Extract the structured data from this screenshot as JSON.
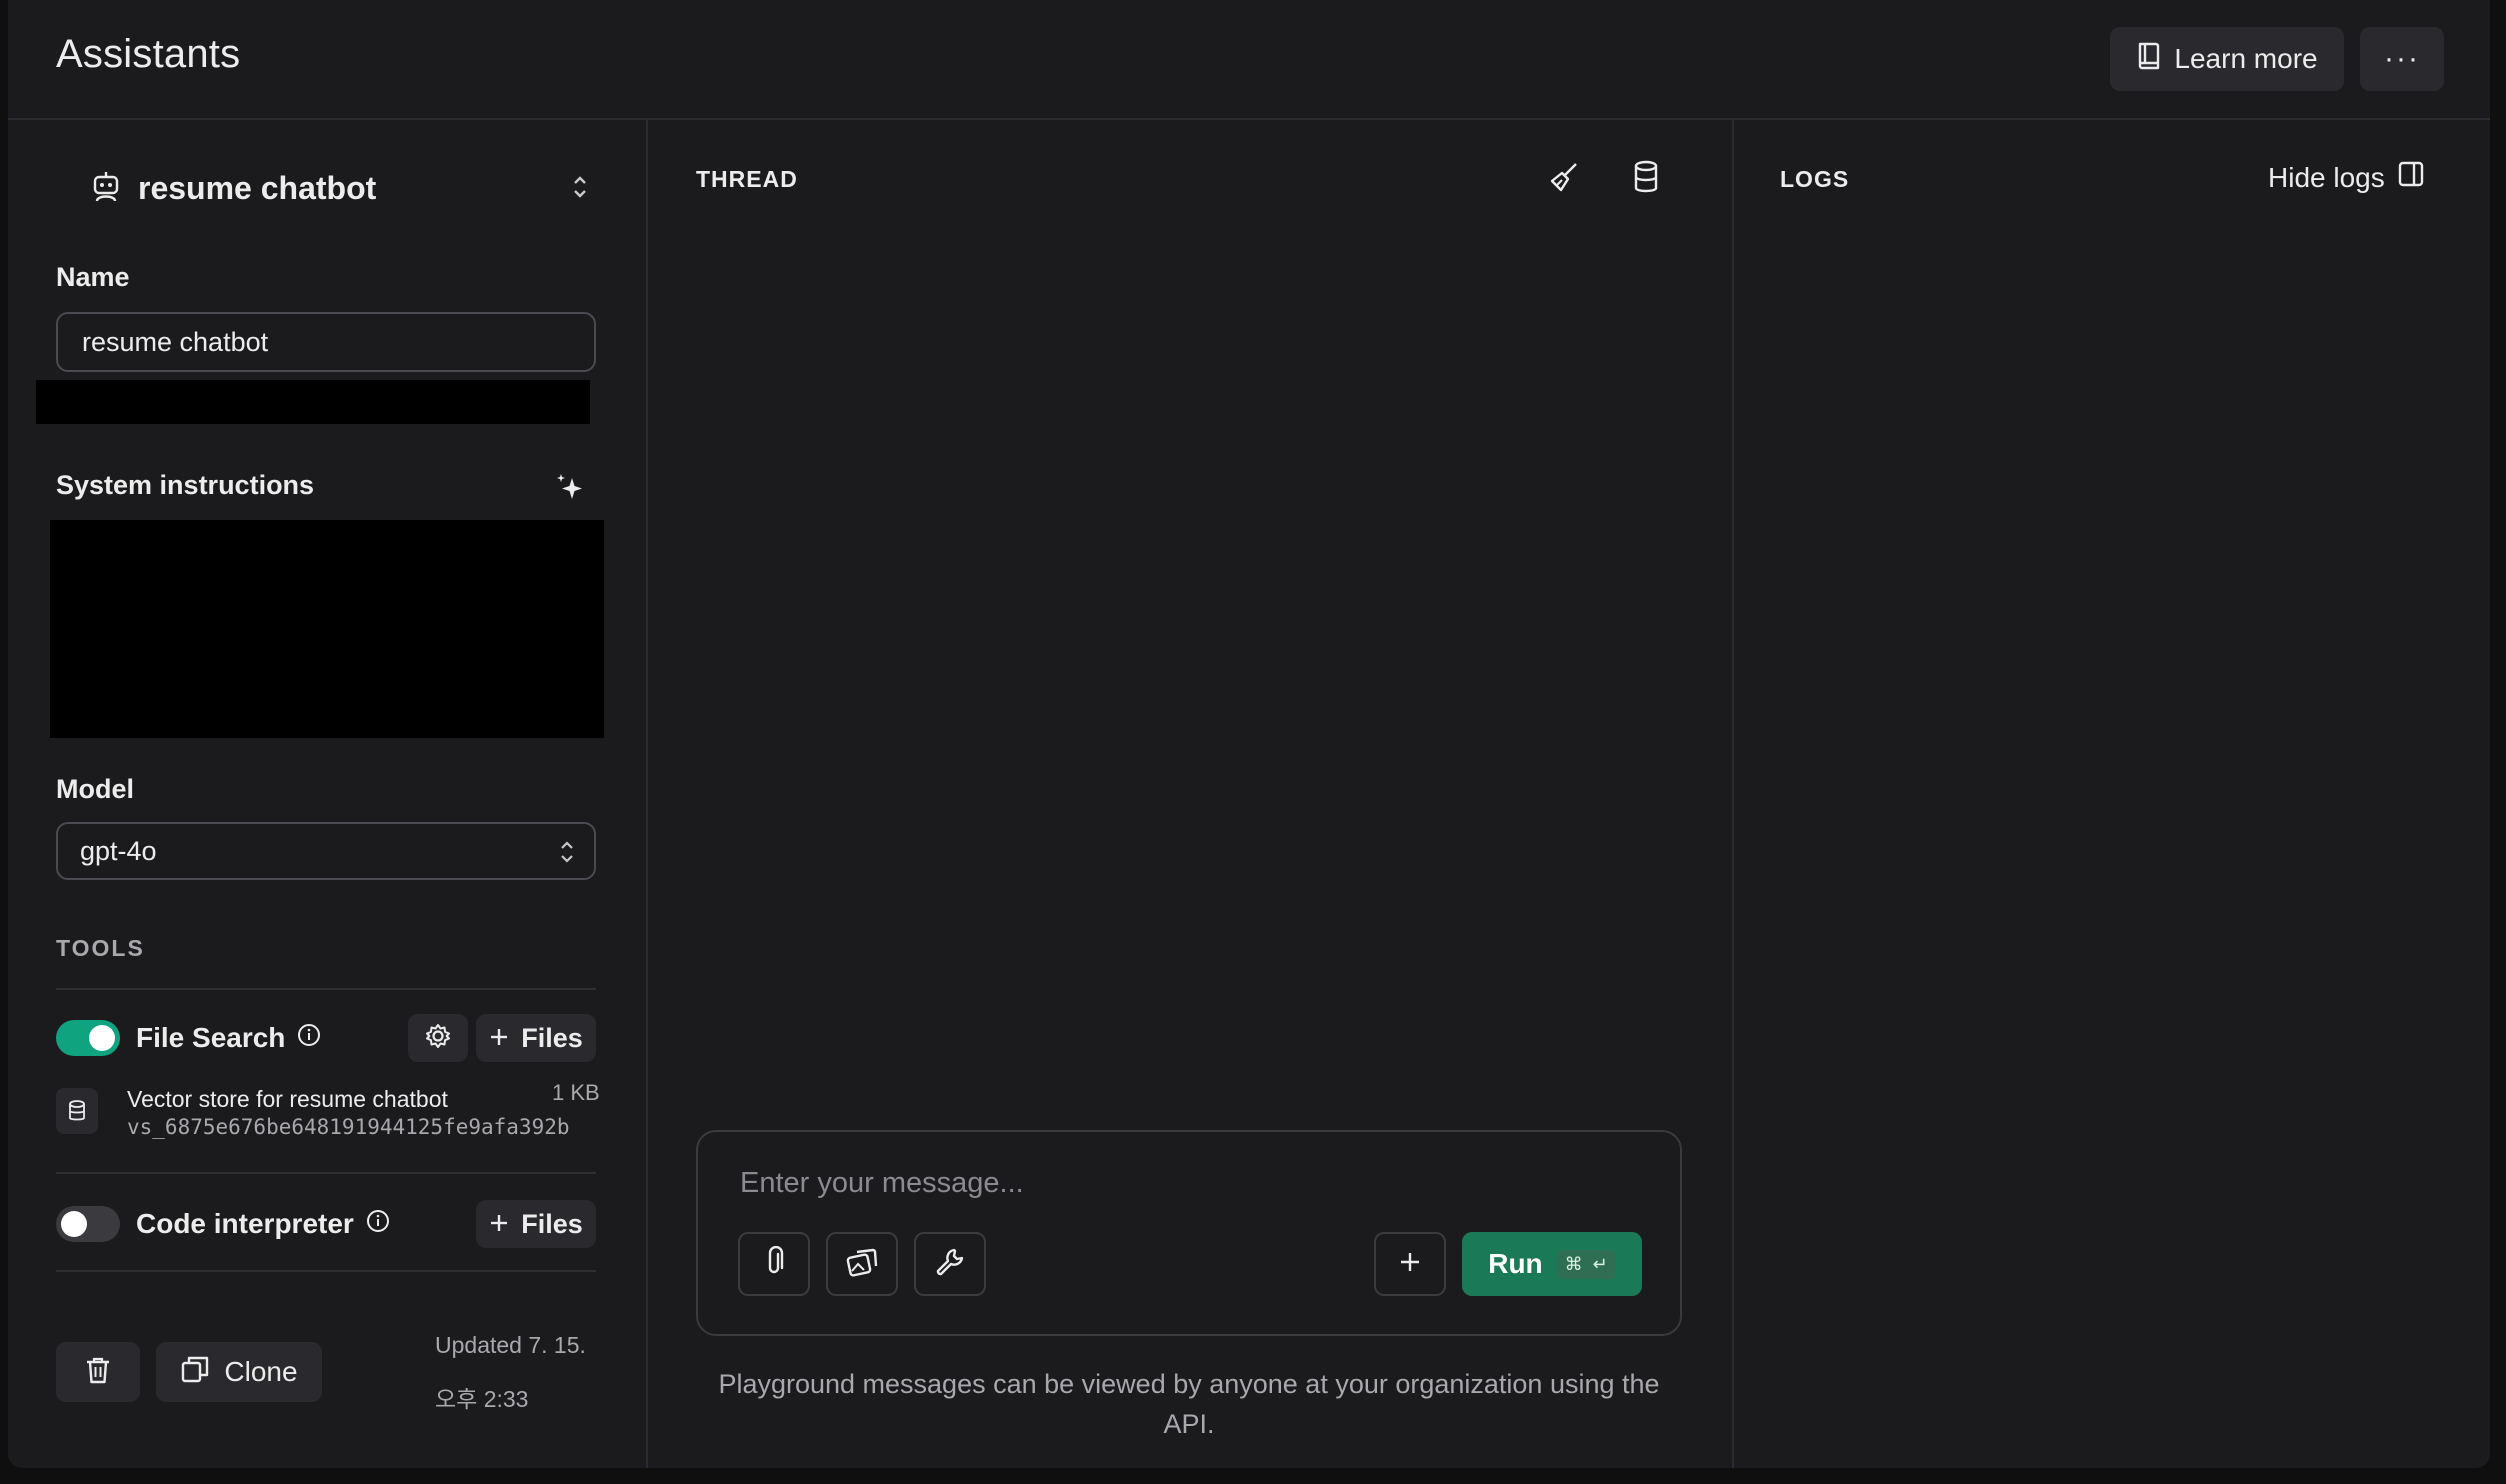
{
  "header": {
    "title": "Assistants",
    "learn_more_label": "Learn more",
    "more_label": "···"
  },
  "assistant": {
    "selected_name": "resume chatbot",
    "name_label": "Name",
    "name_value": "resume chatbot",
    "instructions_label": "System instructions",
    "model_label": "Model",
    "model_value": "gpt-4o"
  },
  "tools": {
    "section_label": "TOOLS",
    "file_search": {
      "label": "File Search",
      "enabled": true,
      "files_label": "Files",
      "vector_store": {
        "name": "Vector store for resume chatbot",
        "id": "vs_6875e676be648191944125fe9afa392b",
        "size": "1 KB"
      }
    },
    "code_interpreter": {
      "label": "Code interpreter",
      "enabled": false,
      "files_label": "Files"
    }
  },
  "footer": {
    "clone_label": "Clone",
    "updated_line1": "Updated 7. 15.",
    "updated_line2": "오후 2:33"
  },
  "thread": {
    "title": "THREAD",
    "message_placeholder": "Enter your message...",
    "run_label": "Run",
    "shortcut_cmd": "⌘",
    "shortcut_enter": "↵",
    "notice": "Playground messages can be viewed by anyone at your organization using the API."
  },
  "logs": {
    "title": "LOGS",
    "hide_label": "Hide logs"
  },
  "colors": {
    "background": "#1b1b1d",
    "accent_green": "#10a37f",
    "run_button": "#1a7a57",
    "border": "#2c2c30"
  }
}
